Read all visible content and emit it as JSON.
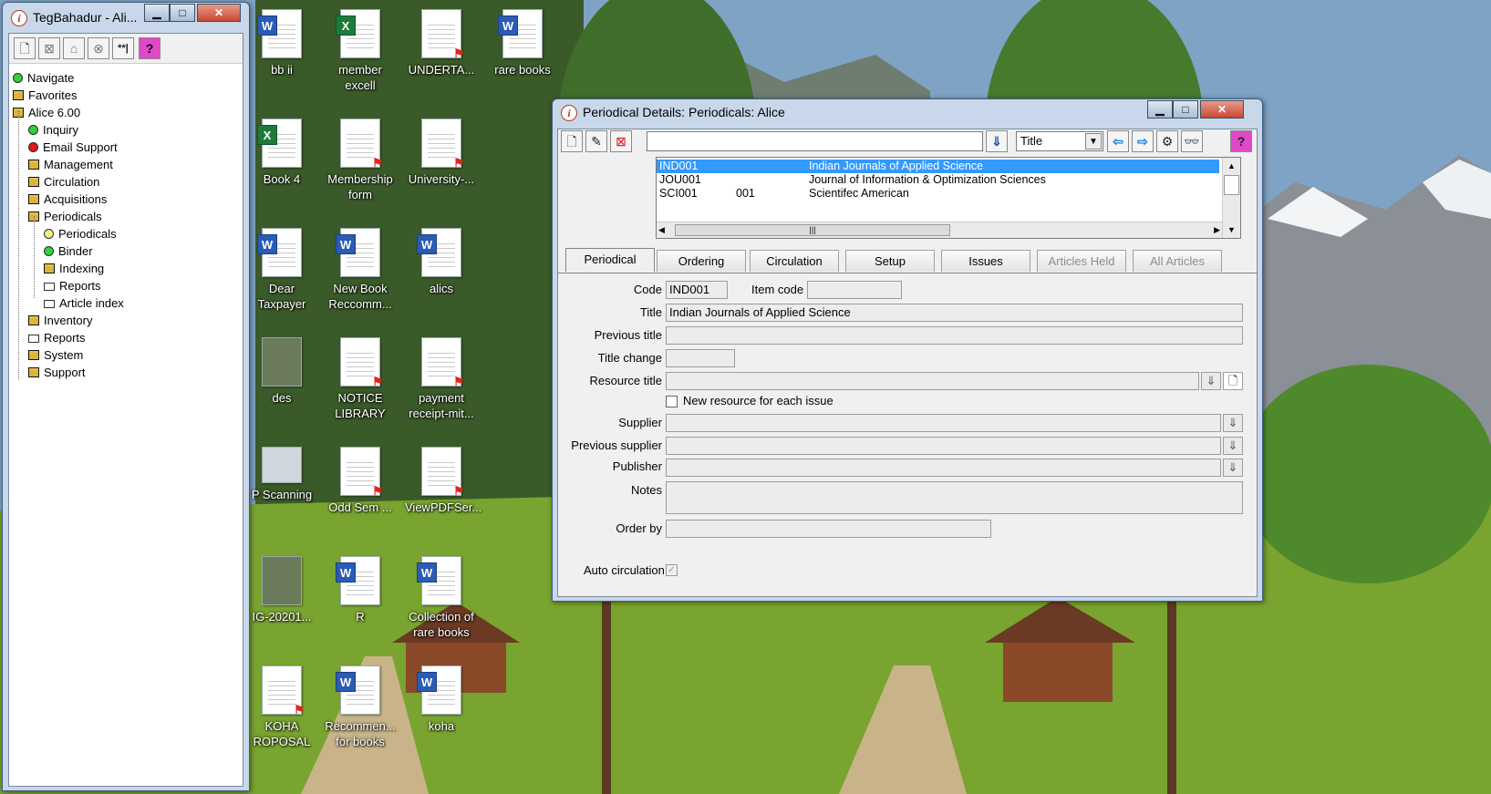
{
  "left_window": {
    "title": "TegBahadur - Ali...",
    "tree": [
      {
        "label": "Navigate",
        "icon": "green-dot-icon"
      },
      {
        "label": "Favorites",
        "icon": "folder-icon"
      },
      {
        "label": "Alice 6.00",
        "icon": "folder-icon"
      },
      {
        "label": "Inquiry",
        "icon": "green-dot-icon"
      },
      {
        "label": "Email Support",
        "icon": "red-dot-icon"
      },
      {
        "label": "Management",
        "icon": "folder-icon"
      },
      {
        "label": "Circulation",
        "icon": "folder-icon"
      },
      {
        "label": "Acquisitions",
        "icon": "folder-icon"
      },
      {
        "label": "Periodicals",
        "icon": "folder-icon"
      },
      {
        "label": "Periodicals",
        "icon": "yellow-dot-icon"
      },
      {
        "label": "Binder",
        "icon": "green-dot-icon"
      },
      {
        "label": "Indexing",
        "icon": "folder-icon"
      },
      {
        "label": "Reports",
        "icon": "printer-icon"
      },
      {
        "label": "Article index",
        "icon": "printer-icon"
      },
      {
        "label": "Inventory",
        "icon": "folder-icon"
      },
      {
        "label": "Reports",
        "icon": "printer-icon"
      },
      {
        "label": "System",
        "icon": "folder-icon"
      },
      {
        "label": "Support",
        "icon": "folder-icon"
      }
    ]
  },
  "desktop_icons": [
    {
      "label": "bb ii",
      "kind": "word"
    },
    {
      "label": "member excell",
      "kind": "excel"
    },
    {
      "label": "UNDERTA...",
      "kind": "pdf"
    },
    {
      "label": "rare books",
      "kind": "word"
    },
    {
      "label": "Book 4",
      "kind": "excel"
    },
    {
      "label": "Membership form",
      "kind": "pdf"
    },
    {
      "label": "University-...",
      "kind": "pdf"
    },
    {
      "label": "Dear Taxpayer",
      "kind": "word"
    },
    {
      "label": "New Book Reccomm...",
      "kind": "word"
    },
    {
      "label": "alics",
      "kind": "word"
    },
    {
      "label": "des",
      "kind": "image"
    },
    {
      "label": "NOTICE LIBRARY",
      "kind": "pdf"
    },
    {
      "label": "payment receipt-mit...",
      "kind": "pdf"
    },
    {
      "label": "P Scanning",
      "kind": "scanner"
    },
    {
      "label": "Odd Sem ...",
      "kind": "pdf"
    },
    {
      "label": "ViewPDFSer...",
      "kind": "pdf"
    },
    {
      "label": "IG-20201...",
      "kind": "image"
    },
    {
      "label": "R",
      "kind": "word"
    },
    {
      "label": "Collection of rare books",
      "kind": "word"
    },
    {
      "label": "KOHA ROPOSAL",
      "kind": "pdf"
    },
    {
      "label": "Recommen... for books",
      "kind": "word"
    },
    {
      "label": "koha",
      "kind": "word"
    }
  ],
  "periodical_window": {
    "title": "Periodical Details: Periodicals: Alice",
    "search_value": "",
    "sort_select": "Title",
    "list": [
      {
        "code": "IND001",
        "item": "",
        "title": "Indian Journals of Applied Science",
        "selected": true
      },
      {
        "code": "JOU001",
        "item": "",
        "title": "Journal of Information & Optimization Sciences",
        "selected": false
      },
      {
        "code": "SCI001",
        "item": "001",
        "title": "Scientifec American",
        "selected": false
      }
    ],
    "tabs": [
      {
        "label": "Periodical",
        "state": "active"
      },
      {
        "label": "Ordering",
        "state": "normal"
      },
      {
        "label": "Circulation",
        "state": "normal"
      },
      {
        "label": "Setup",
        "state": "normal"
      },
      {
        "label": "Issues",
        "state": "normal"
      },
      {
        "label": "Articles Held",
        "state": "disabled"
      },
      {
        "label": "All Articles",
        "state": "disabled"
      }
    ],
    "form": {
      "code_label": "Code",
      "code_value": "IND001",
      "item_code_label": "Item code",
      "item_code_value": "",
      "title_label": "Title",
      "title_value": "Indian Journals of Applied Science",
      "previous_title_label": "Previous title",
      "previous_title_value": "",
      "title_change_label": "Title change",
      "title_change_value": "",
      "resource_title_label": "Resource title",
      "resource_title_value": "",
      "new_resource_label": "New resource for each issue",
      "supplier_label": "Supplier",
      "supplier_value": "",
      "previous_supplier_label": "Previous supplier",
      "previous_supplier_value": "",
      "publisher_label": "Publisher",
      "publisher_value": "",
      "notes_label": "Notes",
      "notes_value": "",
      "order_by_label": "Order by",
      "order_by_value": "",
      "auto_circulation_label": "Auto circulation"
    }
  }
}
